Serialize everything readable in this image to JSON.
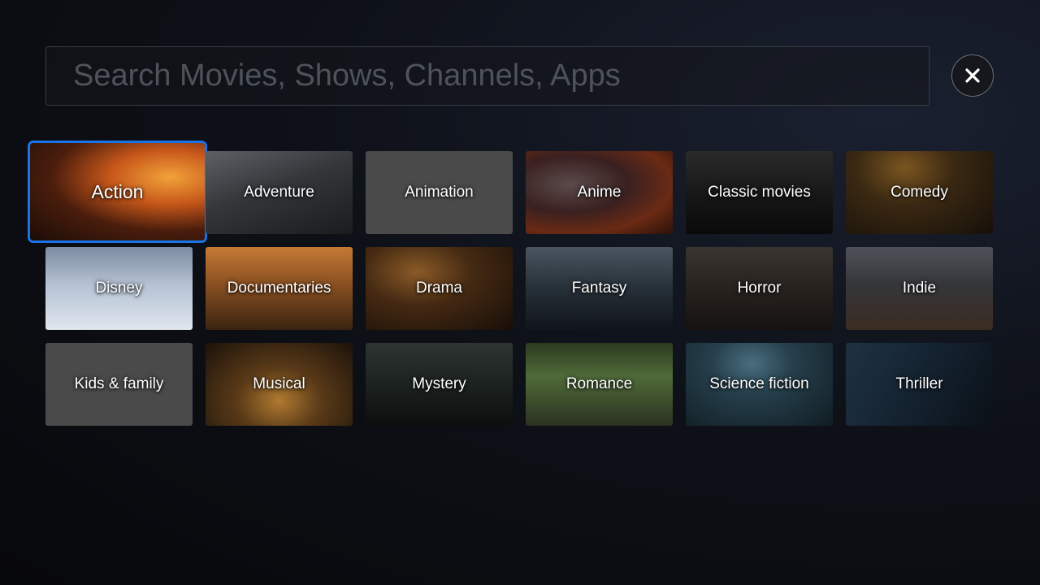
{
  "search": {
    "placeholder": "Search Movies, Shows, Channels, Apps",
    "value": ""
  },
  "close_button": {
    "icon": "close-icon"
  },
  "focus_color": "#1a74e8",
  "genres": [
    {
      "label": "Action",
      "focused": true
    },
    {
      "label": "Adventure"
    },
    {
      "label": "Animation"
    },
    {
      "label": "Anime"
    },
    {
      "label": "Classic movies"
    },
    {
      "label": "Comedy"
    },
    {
      "label": "Disney"
    },
    {
      "label": "Documentaries"
    },
    {
      "label": "Drama"
    },
    {
      "label": "Fantasy"
    },
    {
      "label": "Horror"
    },
    {
      "label": "Indie"
    },
    {
      "label": "Kids & family"
    },
    {
      "label": "Musical"
    },
    {
      "label": "Mystery"
    },
    {
      "label": "Romance"
    },
    {
      "label": "Science fiction"
    },
    {
      "label": "Thriller"
    }
  ]
}
